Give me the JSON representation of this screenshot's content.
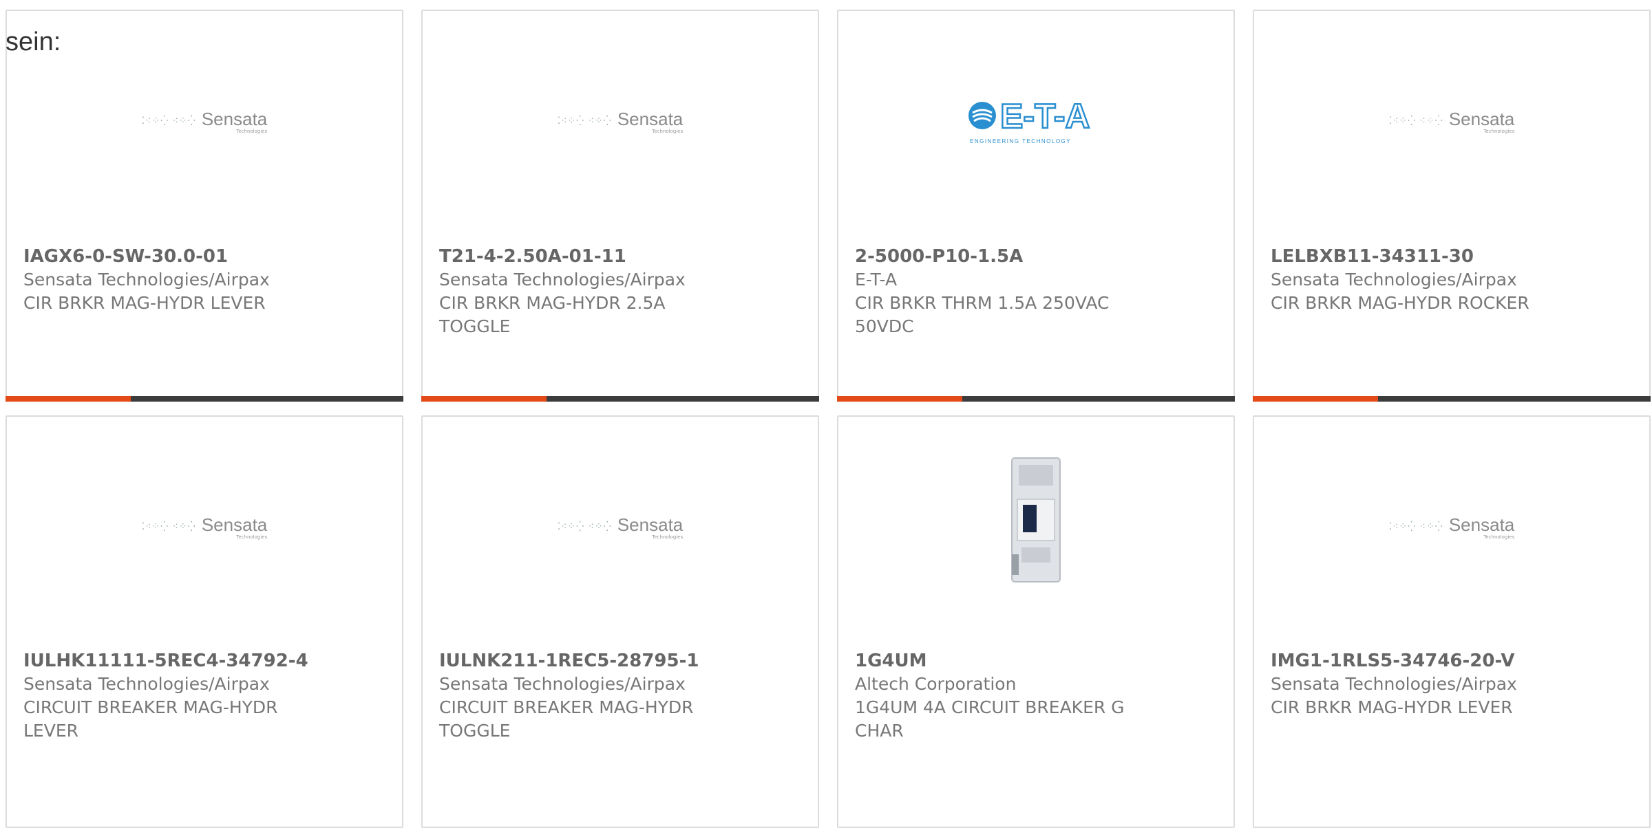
{
  "intro_text": "sein:",
  "accent_color": "#e34a17",
  "cards": [
    {
      "part_number": "IAGX6-0-SW-30.0-01",
      "manufacturer": "Sensata Technologies/Airpax",
      "desc_line1": "CIR BRKR MAG-HYDR LEVER",
      "desc_line2": "",
      "logo": "sensata-logo",
      "logo_text": "Sensata",
      "logo_sub": "Technologies"
    },
    {
      "part_number": "T21-4-2.50A-01-11",
      "manufacturer": "Sensata Technologies/Airpax",
      "desc_line1": "CIR BRKR MAG-HYDR 2.5A",
      "desc_line2": "TOGGLE",
      "logo": "sensata-logo",
      "logo_text": "Sensata",
      "logo_sub": "Technologies"
    },
    {
      "part_number": "2-5000-P10-1.5A",
      "manufacturer": "E-T-A",
      "desc_line1": "CIR BRKR THRM 1.5A 250VAC",
      "desc_line2": "50VDC",
      "logo": "eta-logo",
      "logo_text": "E-T-A",
      "logo_sub": "ENGINEERING TECHNOLOGY"
    },
    {
      "part_number": "LELBXB11-34311-30",
      "manufacturer": "Sensata Technologies/Airpax",
      "desc_line1": "CIR BRKR MAG-HYDR ROCKER",
      "desc_line2": "",
      "logo": "sensata-logo",
      "logo_text": "Sensata",
      "logo_sub": "Technologies"
    },
    {
      "part_number": "IULHK11111-5REC4-34792-4",
      "manufacturer": "Sensata Technologies/Airpax",
      "desc_line1": "CIRCUIT BREAKER MAG-HYDR",
      "desc_line2": "LEVER",
      "logo": "sensata-logo",
      "logo_text": "Sensata",
      "logo_sub": "Technologies"
    },
    {
      "part_number": "IULNK211-1REC5-28795-1",
      "manufacturer": "Sensata Technologies/Airpax",
      "desc_line1": "CIRCUIT BREAKER MAG-HYDR",
      "desc_line2": "TOGGLE",
      "logo": "sensata-logo",
      "logo_text": "Sensata",
      "logo_sub": "Technologies"
    },
    {
      "part_number": "1G4UM",
      "manufacturer": "Altech Corporation",
      "desc_line1": "1G4UM 4A CIRCUIT BREAKER G",
      "desc_line2": "CHAR",
      "logo": "circuit-breaker-image",
      "logo_text": "",
      "logo_sub": ""
    },
    {
      "part_number": "IMG1-1RLS5-34746-20-V",
      "manufacturer": "Sensata Technologies/Airpax",
      "desc_line1": "CIR BRKR MAG-HYDR LEVER",
      "desc_line2": "",
      "logo": "sensata-logo",
      "logo_text": "Sensata",
      "logo_sub": "Technologies"
    }
  ]
}
